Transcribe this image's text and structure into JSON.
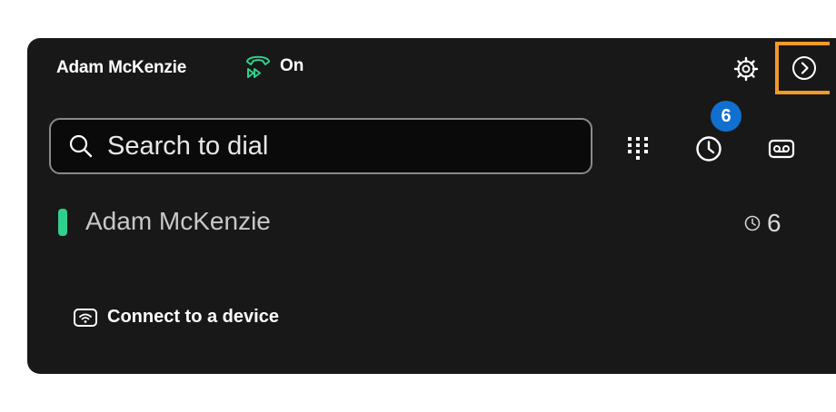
{
  "header": {
    "user_name": "Adam McKenzie",
    "status_label": "On",
    "status_icon": "call-forward-icon",
    "settings_icon": "gear-icon",
    "expand_icon": "chevron-right-circle-icon",
    "highlight_color": "#f39a28"
  },
  "search": {
    "placeholder": "Search to dial",
    "value": ""
  },
  "actions": {
    "dialpad_icon": "dialpad-icon",
    "recents_icon": "clock-icon",
    "recents_badge": "6",
    "voicemail_icon": "voicemail-icon",
    "badge_color": "#1170cf"
  },
  "line": {
    "name": "Adam McKenzie",
    "indicator_color": "#2fcf8c",
    "recent_count": "6"
  },
  "device": {
    "label": "Connect to a device",
    "icon": "wifi-device-icon"
  }
}
